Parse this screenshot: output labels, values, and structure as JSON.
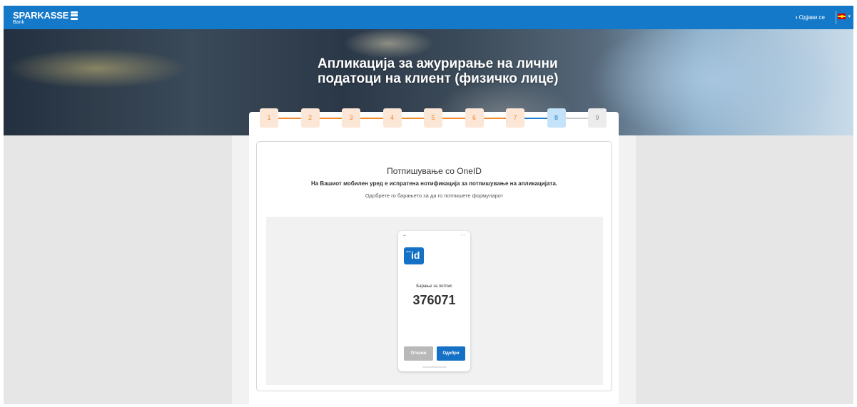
{
  "header": {
    "brand": "SPARKASSE",
    "brand_sub": "Bank",
    "logout_label": "Одјави се",
    "language_icon": "mk-flag-icon"
  },
  "hero": {
    "title": "Апликација за ажурирање на лични податоци на клиент (физичко лице)"
  },
  "stepper": {
    "active_step": 8,
    "steps": [
      "1",
      "2",
      "3",
      "4",
      "5",
      "6",
      "7",
      "8",
      "9"
    ],
    "colors": {
      "done": "#f08a2c",
      "active": "#1e7fd0",
      "todo": "#8c8c8c"
    }
  },
  "signature": {
    "title": "Потпишување со OneID",
    "notice": "На Вашиот мобилен уред е испратена нотификација за потпишување на апликацијата.",
    "instruction": "Одобрете го барањето за да го потпишете формуларот"
  },
  "phone": {
    "app_logo_small": "one",
    "app_logo_main": "id",
    "request_label": "Барање за потпис",
    "code": "376071",
    "cancel_label": "Откажи",
    "approve_label": "Одобри"
  },
  "colors": {
    "brand": "#1479c9",
    "oneid": "#1571c5"
  }
}
